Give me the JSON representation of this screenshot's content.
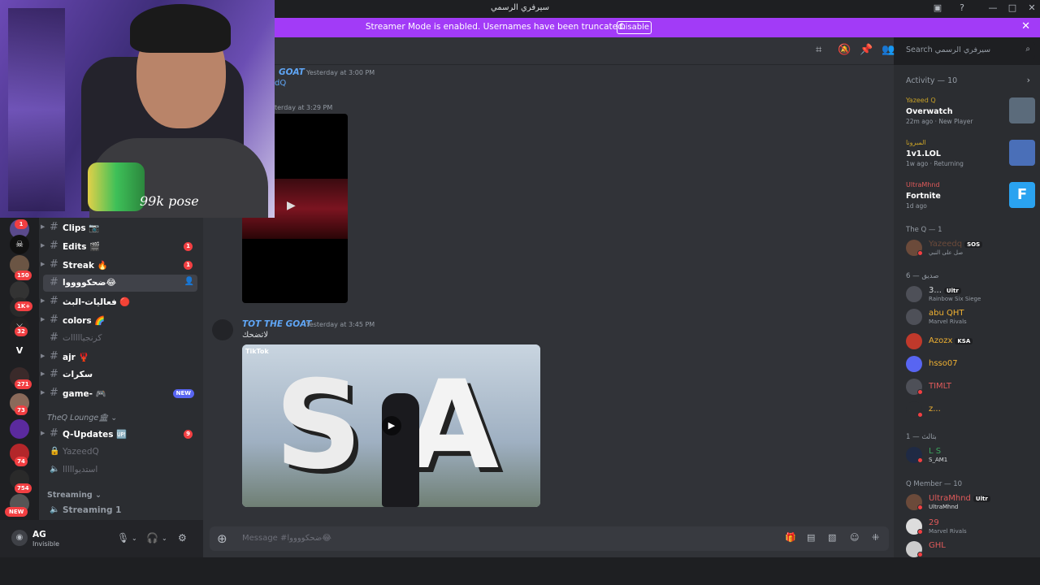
{
  "titlebar": {
    "title": "سيرفري الرسمي"
  },
  "banner": {
    "text": "Streamer Mode is enabled. Usernames have been truncated.",
    "disable_label": "Disable"
  },
  "search": {
    "placeholder": "Search سيرفري الرسمي"
  },
  "rail": {
    "items": [
      {
        "label": "",
        "badge": "1"
      },
      {
        "label": ""
      },
      {
        "label": "",
        "badge": "150"
      },
      {
        "label": ""
      },
      {
        "label": "",
        "badge": "1K+"
      },
      {
        "label": "",
        "badge": "32"
      },
      {
        "label": "V"
      },
      {
        "label": "",
        "badge": "271"
      },
      {
        "label": "",
        "badge": "73"
      },
      {
        "label": ""
      },
      {
        "label": "",
        "badge": "74"
      },
      {
        "label": "",
        "badge": "754"
      },
      {
        "label": "",
        "badge": "NEW"
      }
    ]
  },
  "channels": [
    {
      "name": "Clips 📷",
      "muted": false
    },
    {
      "name": "Edits 🎬",
      "badge": "1"
    },
    {
      "name": "Streak 🔥",
      "badge": "1"
    },
    {
      "name": "ضحكووووا😂",
      "active": true
    },
    {
      "name": "فعاليات-البث 🔴"
    },
    {
      "name": "colors 🌈"
    },
    {
      "name": "كرنجيااااات",
      "muted": true
    },
    {
      "name": "ajr 🦞"
    },
    {
      "name": "سكرات"
    },
    {
      "name": "game- 🎮",
      "new": "NEW"
    }
  ],
  "category_lounge": "TheQ Lounge🏛 ⌄",
  "channels2": [
    {
      "name": "Q-Updates 🆙",
      "badge": "9"
    },
    {
      "name": "YazeedQ",
      "muted": true,
      "icon": "lock"
    },
    {
      "name": "استديوااااا",
      "muted": true,
      "icon": "speaker"
    }
  ],
  "category_streaming": "Streaming ⌄",
  "streaming_channel": "Streaming 1",
  "user": {
    "name": "AG",
    "status": "Invisible"
  },
  "messages": [
    {
      "author": "GOAT",
      "time": "Yesterday at 3:00 PM",
      "text": "dQ"
    },
    {
      "time": "terday at 3:29 PM"
    },
    {
      "author": "TOT THE GOAT",
      "time": "Yesterday at 3:45 PM",
      "text": "لاتضحك"
    }
  ],
  "video": {
    "tiktok_label": "TikTok"
  },
  "composer": {
    "placeholder": "Message #ضحكووووا😂"
  },
  "activity": {
    "header": "Activity — 10",
    "cards": [
      {
        "who": "Yazeed Q",
        "game": "Overwatch",
        "meta": "22m ago · New Player",
        "color": "#5b6b7b"
      },
      {
        "who": "المبرونا",
        "game": "1v1.LOL",
        "meta": "1w ago · Returning",
        "color": "#4a6fb8"
      },
      {
        "who": "UltraMhnd",
        "game": "Fortnite",
        "meta": "1d ago",
        "color": "#2aa3f0"
      }
    ]
  },
  "members": {
    "groups": [
      {
        "title": "The Q — 1"
      },
      {
        "title": "صديق — 6"
      },
      {
        "title": "بثالث — 1"
      },
      {
        "title": "Q Member — 10"
      }
    ],
    "theq": [
      {
        "name": "Yazeedq",
        "tag": "SOS",
        "sub": "صل على النبي"
      }
    ],
    "friends": [
      {
        "name": "3...",
        "tag": "Ultr",
        "sub": "Rainbow Six Siege",
        "color": "#dbdee1"
      },
      {
        "name": "abu QHT",
        "sub": "Marvel Rivals",
        "color": "#f0b132"
      },
      {
        "name": "Azozx",
        "tag": "KSA",
        "color": "#f0b132"
      },
      {
        "name": "hsso07",
        "color": "#f0b132"
      },
      {
        "name": "TIMLT",
        "color": "#e05a5a"
      },
      {
        "name": "z...",
        "color": "#f0b132"
      }
    ],
    "third": [
      {
        "name": "L S",
        "sub": "S_AM1"
      }
    ],
    "qmembers": [
      {
        "name": "UltraMhnd",
        "tag": "Ultr",
        "sub": "UltraMhnd",
        "color": "#e05a5a"
      },
      {
        "name": "29",
        "sub": "Marvel Rivals",
        "color": "#e05a5a"
      },
      {
        "name": "GHL",
        "color": "#e05a5a"
      }
    ]
  },
  "webcam": {
    "signature": "99k pose"
  }
}
